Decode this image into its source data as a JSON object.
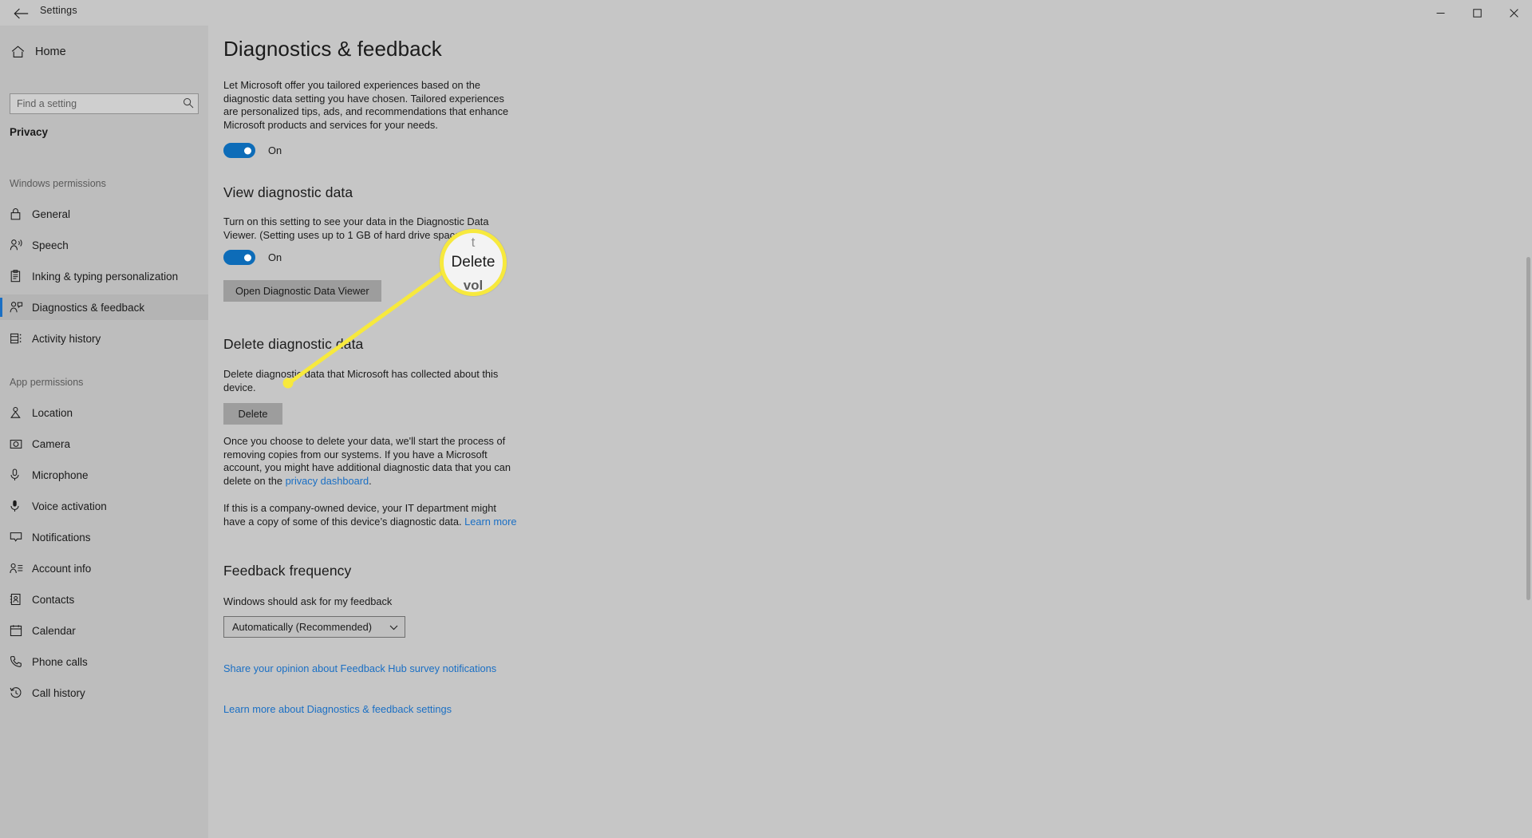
{
  "window": {
    "title": "Settings",
    "back_icon": "back-arrow-icon",
    "minimize_icon": "minimize-icon",
    "maximize_icon": "maximize-icon",
    "close_icon": "close-icon"
  },
  "sidebar": {
    "home_label": "Home",
    "home_icon": "home-icon",
    "search_placeholder": "Find a setting",
    "search_value": "",
    "search_icon": "search-icon",
    "section_title": "Privacy",
    "groups": [
      {
        "heading": "Windows permissions",
        "items": [
          {
            "label": "General",
            "icon": "lock-icon",
            "selected": false
          },
          {
            "label": "Speech",
            "icon": "speech-person-icon",
            "selected": false
          },
          {
            "label": "Inking & typing personalization",
            "icon": "clipboard-pen-icon",
            "selected": false
          },
          {
            "label": "Diagnostics & feedback",
            "icon": "person-feedback-icon",
            "selected": true
          },
          {
            "label": "Activity history",
            "icon": "activity-history-icon",
            "selected": false
          }
        ]
      },
      {
        "heading": "App permissions",
        "items": [
          {
            "label": "Location",
            "icon": "location-pin-icon",
            "selected": false
          },
          {
            "label": "Camera",
            "icon": "camera-icon",
            "selected": false
          },
          {
            "label": "Microphone",
            "icon": "microphone-icon",
            "selected": false
          },
          {
            "label": "Voice activation",
            "icon": "voice-activation-icon",
            "selected": false
          },
          {
            "label": "Notifications",
            "icon": "notification-bubble-icon",
            "selected": false
          },
          {
            "label": "Account info",
            "icon": "account-info-icon",
            "selected": false
          },
          {
            "label": "Contacts",
            "icon": "contacts-book-icon",
            "selected": false
          },
          {
            "label": "Calendar",
            "icon": "calendar-icon",
            "selected": false
          },
          {
            "label": "Phone calls",
            "icon": "phone-icon",
            "selected": false
          },
          {
            "label": "Call history",
            "icon": "call-history-icon",
            "selected": false
          }
        ]
      }
    ]
  },
  "page": {
    "title": "Diagnostics & feedback",
    "tailored_paragraph": "Let Microsoft offer you tailored experiences based on the diagnostic data setting you have chosen. Tailored experiences are personalized tips, ads, and recommendations that enhance Microsoft products and services for your needs.",
    "tailored_toggle_state": "On",
    "view_section": {
      "title": "View diagnostic data",
      "paragraph": "Turn on this setting to see your data in the Diagnostic Data Viewer. (Setting uses up to 1 GB of hard drive space.)",
      "toggle_state": "On",
      "button_label": "Open Diagnostic Data Viewer"
    },
    "delete_section": {
      "title": "Delete diagnostic data",
      "paragraph": "Delete diagnostic data that Microsoft has collected about this device.",
      "button_label": "Delete",
      "note_before_link": "Once you choose to delete your data, we'll start the process of removing copies from our systems. If you have a Microsoft account, you might have additional diagnostic data that you can delete on the ",
      "note_link": "privacy dashboard",
      "note_after_link": ".",
      "company_note_before_link": "If this is a company-owned device, your IT department might have a copy of some of this device’s diagnostic data. ",
      "company_note_link": "Learn more"
    },
    "feedback_section": {
      "title": "Feedback frequency",
      "label": "Windows should ask for my feedback",
      "selected_option": "Automatically (Recommended)",
      "chevron_icon": "chevron-down-icon"
    },
    "bottom_links": [
      "Share your opinion about Feedback Hub survey notifications",
      "Learn more about Diagnostics & feedback settings"
    ]
  },
  "callout": {
    "zoom_text": "Delete",
    "ghost_top": "t",
    "ghost_bottom": "vol",
    "ring_color": "#f7e93d",
    "line_color": "#f7e93d"
  },
  "colors": {
    "accent": "#0d6cb8",
    "link": "#1a6fc4",
    "page_bg": "#c6c6c6",
    "sidebar_bg": "#bdbdbd",
    "button_bg": "#9d9d9d",
    "highlight": "#f7e93d"
  }
}
